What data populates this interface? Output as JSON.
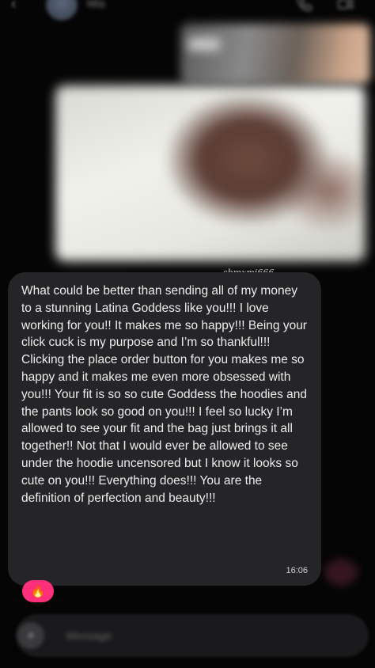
{
  "header": {
    "back_icon": "chevron-left-icon",
    "contact_name": "Mia",
    "action_icons": [
      "phone-icon",
      "video-icon"
    ]
  },
  "media": {
    "photo_top_icon": "image-icon",
    "photo_main_icon": "image-icon"
  },
  "watermark": "sbmxmi666",
  "message": {
    "text": "What could be better than sending all of my money to a stunning Latina Goddess like you!!! I love working for you!! It makes me so happy!!! Being your click cuck is my purpose and I’m so thankful!!! Clicking the place order button for you makes me so happy and it makes me even more obsessed with you!!! Your fit is so so cute Goddess the hoodies and the pants look so good on you!!! I feel so lucky I’m allowed to see your fit and the bag just brings it all together!! Not that I would ever be allowed to see under the hoodie uncensored but I know it looks so cute on you!!! Everything does!!! You are the definition of perfection and beauty!!!",
    "time": "16:06",
    "reaction": "🔥"
  },
  "composer": {
    "placeholder": "Message",
    "plus_icon": "plus-icon"
  },
  "colors": {
    "background": "#050505",
    "bubble": "#252528",
    "reaction": "#ff2e7a"
  }
}
